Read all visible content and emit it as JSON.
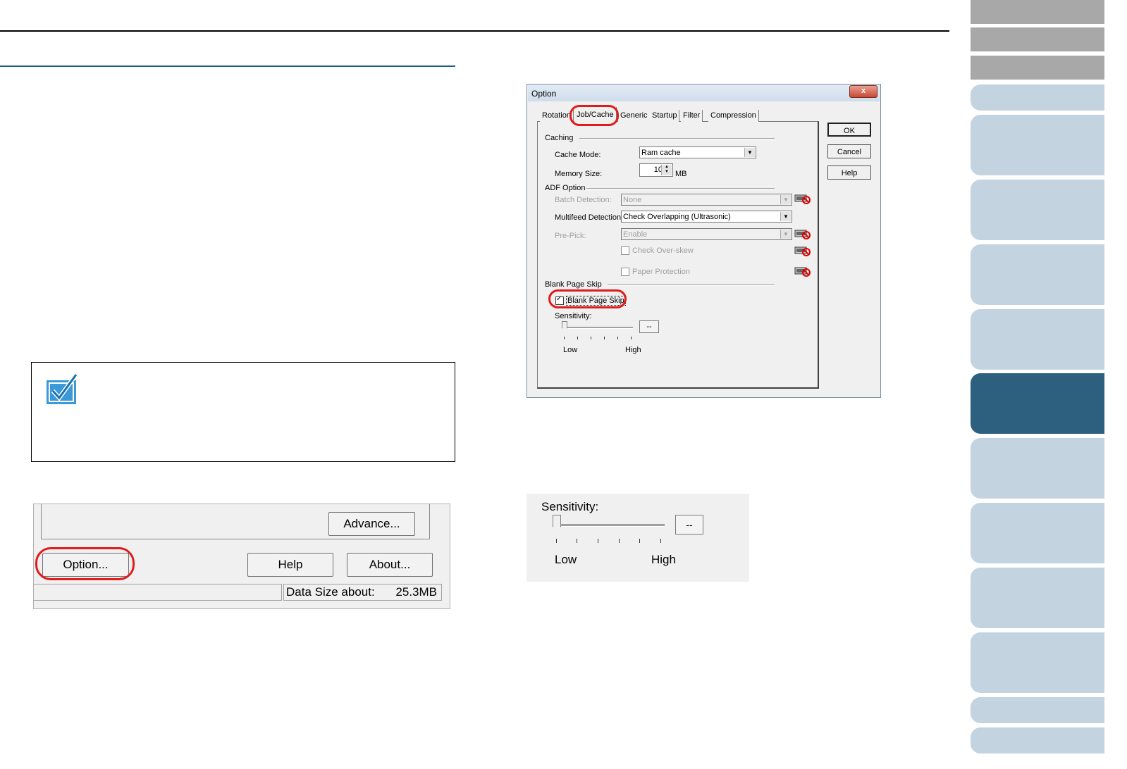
{
  "dialog": {
    "title": "Option",
    "close_label": "x",
    "tabs": [
      "Rotation",
      "Job/Cache",
      "Generic",
      "Startup",
      "Filter",
      "Compression"
    ],
    "caching_group": "Caching",
    "cache_mode_label": "Cache Mode:",
    "cache_mode_value": "Ram cache",
    "memory_size_label": "Memory Size:",
    "memory_size_value": "10",
    "memory_unit": "MB",
    "adf_group": "ADF Option",
    "batch_detection_label": "Batch Detection:",
    "batch_detection_value": "None",
    "multifeed_label": "Multifeed Detection:",
    "multifeed_value": "Check Overlapping (Ultrasonic)",
    "prepick_label": "Pre-Pick:",
    "prepick_value": "Enable",
    "check_overskew_label": "Check Over-skew",
    "paper_protection_label": "Paper Protection",
    "blank_group": "Blank Page Skip",
    "blank_checkbox_label": "Blank Page Skip",
    "sensitivity_label": "Sensitivity:",
    "sensitivity_value": "--",
    "low_label": "Low",
    "high_label": "High",
    "ok_label": "OK",
    "cancel_label": "Cancel",
    "help_label": "Help"
  },
  "crop_main": {
    "advance_label": "Advance...",
    "option_label": "Option...",
    "help_label": "Help",
    "about_label": "About...",
    "data_size_label": "Data Size about:",
    "data_size_value": "25.3MB"
  },
  "crop_sensitivity": {
    "sensitivity_label": "Sensitivity:",
    "value": "--",
    "low_label": "Low",
    "high_label": "High"
  },
  "colors": {
    "accent_blue": "#2d5f7f",
    "tab_light": "#c3d3e0",
    "highlight_red": "#e01b1b"
  }
}
